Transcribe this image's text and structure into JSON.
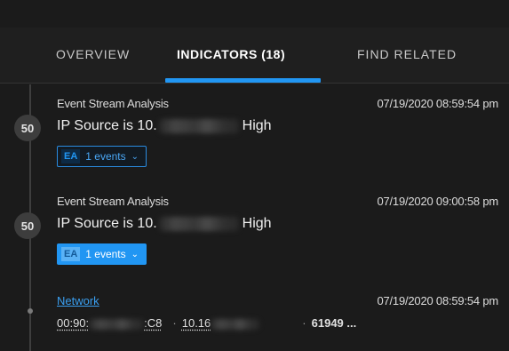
{
  "tabs": [
    {
      "label": "OVERVIEW",
      "active": false
    },
    {
      "label": "INDICATORS (18)",
      "active": true
    },
    {
      "label": "FIND RELATED",
      "active": false
    }
  ],
  "indicators": [
    {
      "score": "50",
      "source": "Event Stream Analysis",
      "timestamp": "07/19/2020 08:59:54 pm",
      "desc_prefix": "IP Source is 10.",
      "desc_suffix": "High",
      "events_tag": "EA",
      "events_label": "1 events",
      "events_state": "outline"
    },
    {
      "score": "50",
      "source": "Event Stream Analysis",
      "timestamp": "07/19/2020 09:00:58 pm",
      "desc_prefix": "IP Source is 10.",
      "desc_suffix": "High",
      "events_tag": "EA",
      "events_label": "1 events",
      "events_state": "filled"
    }
  ],
  "network_event": {
    "link": "Network",
    "timestamp": "07/19/2020 08:59:54 pm",
    "mac_prefix": "00:90:",
    "mac_suffix": ":C8",
    "ip_prefix": "10.16",
    "port": "61949 ..."
  },
  "colors": {
    "accent": "#2196f3",
    "background": "#1b1b1b",
    "badge": "#3d3d3d"
  },
  "icons": {
    "events_dropdown": "chevron-down-icon"
  }
}
